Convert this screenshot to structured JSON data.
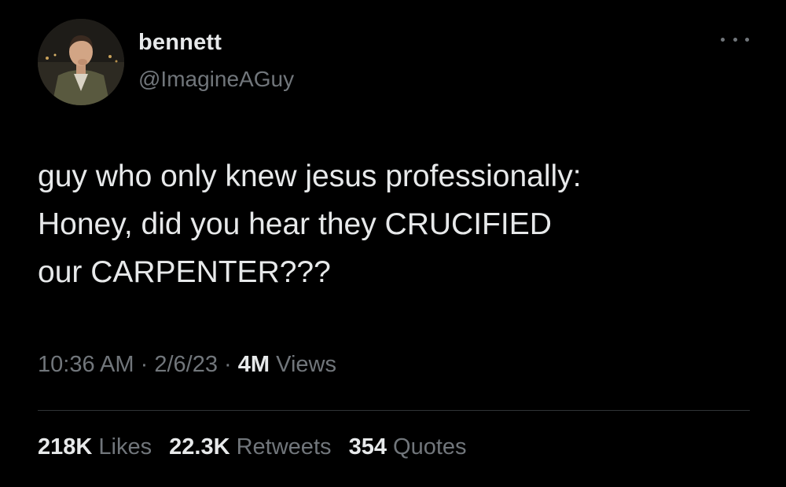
{
  "author": {
    "display_name": "bennett",
    "handle": "@ImagineAGuy",
    "avatar_icon": "profile-photo"
  },
  "more_icon": "more-horizontal-icon",
  "tweet": {
    "lines": [
      "guy who only knew jesus professionally:",
      "Honey, did you hear they CRUCIFIED",
      "our CARPENTER???"
    ]
  },
  "meta": {
    "time": "10:36 AM",
    "separator": "·",
    "date": "2/6/23",
    "views_count": "4M",
    "views_label": "Views"
  },
  "stats": {
    "likes_count": "218K",
    "likes_label": "Likes",
    "retweets_count": "22.3K",
    "retweets_label": "Retweets",
    "quotes_count": "354",
    "quotes_label": "Quotes"
  },
  "colors": {
    "background": "#000000",
    "primary_text": "#e7e9ea",
    "secondary_text": "#71767b",
    "divider": "#2f3336"
  }
}
